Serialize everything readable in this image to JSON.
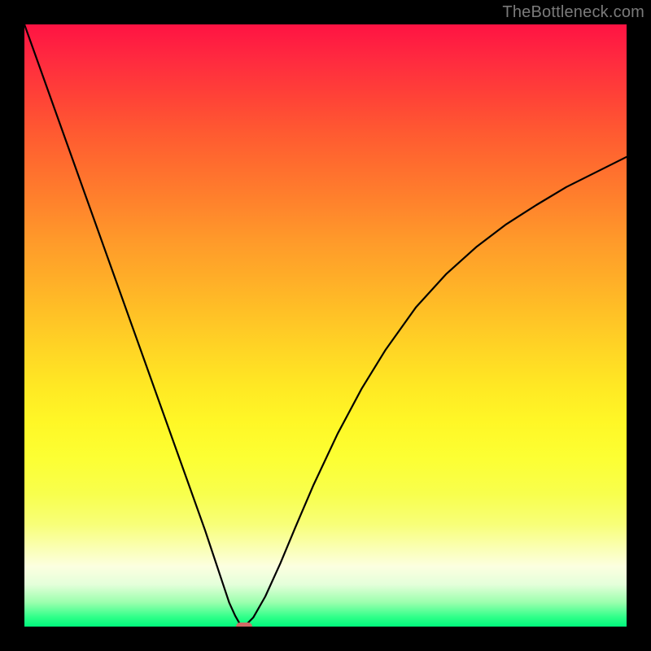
{
  "watermark": {
    "text": "TheBottleneck.com"
  },
  "chart_data": {
    "type": "line",
    "title": "",
    "xlabel": "",
    "ylabel": "",
    "xlim": [
      0,
      100
    ],
    "ylim": [
      0,
      100
    ],
    "grid": false,
    "legend": false,
    "background_gradient": {
      "direction": "vertical",
      "stops": [
        {
          "pos": 0.0,
          "color": "#ff1343"
        },
        {
          "pos": 0.5,
          "color": "#ffc726"
        },
        {
          "pos": 0.85,
          "color": "#fbff8a"
        },
        {
          "pos": 1.0,
          "color": "#00f77d"
        }
      ]
    },
    "series": [
      {
        "name": "bottleneck-curve",
        "color": "#000000",
        "x": [
          0.0,
          2.5,
          5.0,
          7.5,
          10.0,
          12.5,
          15.0,
          17.5,
          20.0,
          22.5,
          25.0,
          27.5,
          30.0,
          31.5,
          33.0,
          34.0,
          35.0,
          35.8,
          36.5,
          38.0,
          40.0,
          42.5,
          45.0,
          48.0,
          52.0,
          56.0,
          60.0,
          65.0,
          70.0,
          75.0,
          80.0,
          85.0,
          90.0,
          95.0,
          100.0
        ],
        "y": [
          100.0,
          93.0,
          86.0,
          79.0,
          72.0,
          65.0,
          58.0,
          51.0,
          44.0,
          37.0,
          30.0,
          23.0,
          16.0,
          11.5,
          7.0,
          4.0,
          1.8,
          0.4,
          0.0,
          1.5,
          5.0,
          10.5,
          16.5,
          23.5,
          32.0,
          39.5,
          46.0,
          53.0,
          58.5,
          63.0,
          66.8,
          70.0,
          73.0,
          75.5,
          78.0
        ]
      }
    ],
    "marker": {
      "name": "optimal-point",
      "x": 36.5,
      "y": 0.0,
      "color": "#d06a66",
      "shape": "pill"
    }
  }
}
